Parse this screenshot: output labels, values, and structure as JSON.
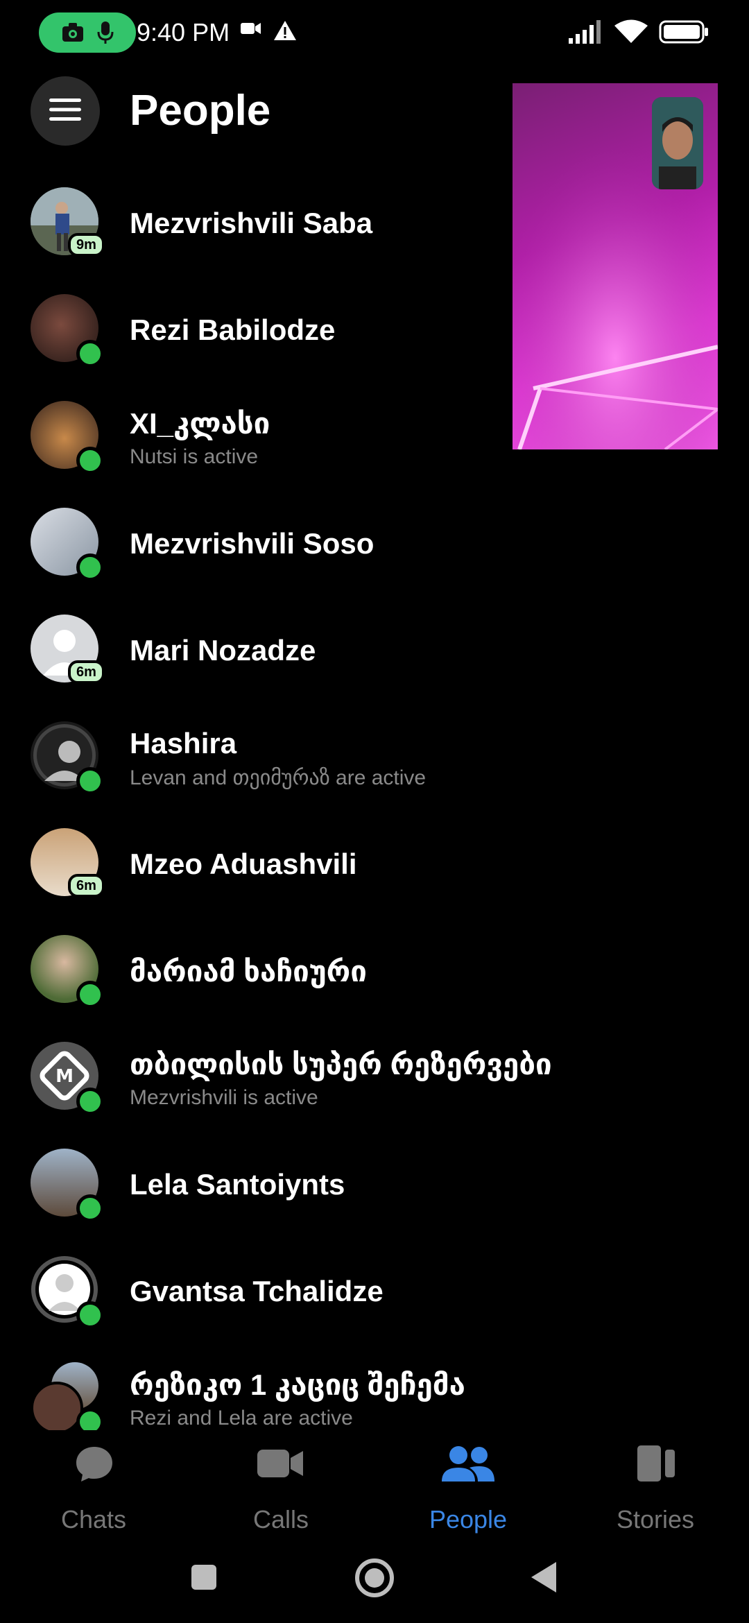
{
  "status_bar": {
    "time": "9:40 PM",
    "icons": [
      "camera-icon",
      "mic-icon",
      "video-icon",
      "warning-icon",
      "signal-icon",
      "wifi-icon",
      "battery-icon"
    ],
    "pill_color": "#33c46b"
  },
  "header": {
    "title": "People",
    "menu_icon": "menu-icon"
  },
  "people": [
    {
      "name": "Mezvrishvili Saba",
      "subtitle": "",
      "status": "badge",
      "badge": "9m"
    },
    {
      "name": "Rezi Babilodze",
      "subtitle": "",
      "status": "online"
    },
    {
      "name": "XI_კლასი",
      "subtitle": "Nutsi is active",
      "status": "online"
    },
    {
      "name": "Mezvrishvili Soso",
      "subtitle": "",
      "status": "online"
    },
    {
      "name": "Mari Nozadze",
      "subtitle": "",
      "status": "badge",
      "badge": "6m"
    },
    {
      "name": "Hashira",
      "subtitle": "Levan and თეიმურაზ are active",
      "status": "online"
    },
    {
      "name": "Mzeo Aduashvili",
      "subtitle": "",
      "status": "badge",
      "badge": "6m"
    },
    {
      "name": "მარიამ ხაჩიური",
      "subtitle": "",
      "status": "online"
    },
    {
      "name": "თბილისის სუპერ რეზერვები",
      "subtitle": "Mezvrishvili is active",
      "status": "online"
    },
    {
      "name": "Lela Santoiynts",
      "subtitle": "",
      "status": "online"
    },
    {
      "name": "Gvantsa Tchalidze",
      "subtitle": "",
      "status": "online"
    },
    {
      "name": "რეზიკო 1 კაციც შეჩემა",
      "subtitle": "Rezi and Lela are active",
      "status": "online"
    }
  ],
  "bottom_nav": [
    {
      "label": "Chats",
      "icon": "chat-bubble-icon",
      "active": false
    },
    {
      "label": "Calls",
      "icon": "video-camera-icon",
      "active": false
    },
    {
      "label": "People",
      "icon": "people-icon",
      "active": true
    },
    {
      "label": "Stories",
      "icon": "stories-icon",
      "active": false
    }
  ],
  "colors": {
    "active": "#3a86e5",
    "online": "#31c14e",
    "inactive": "#777777"
  }
}
